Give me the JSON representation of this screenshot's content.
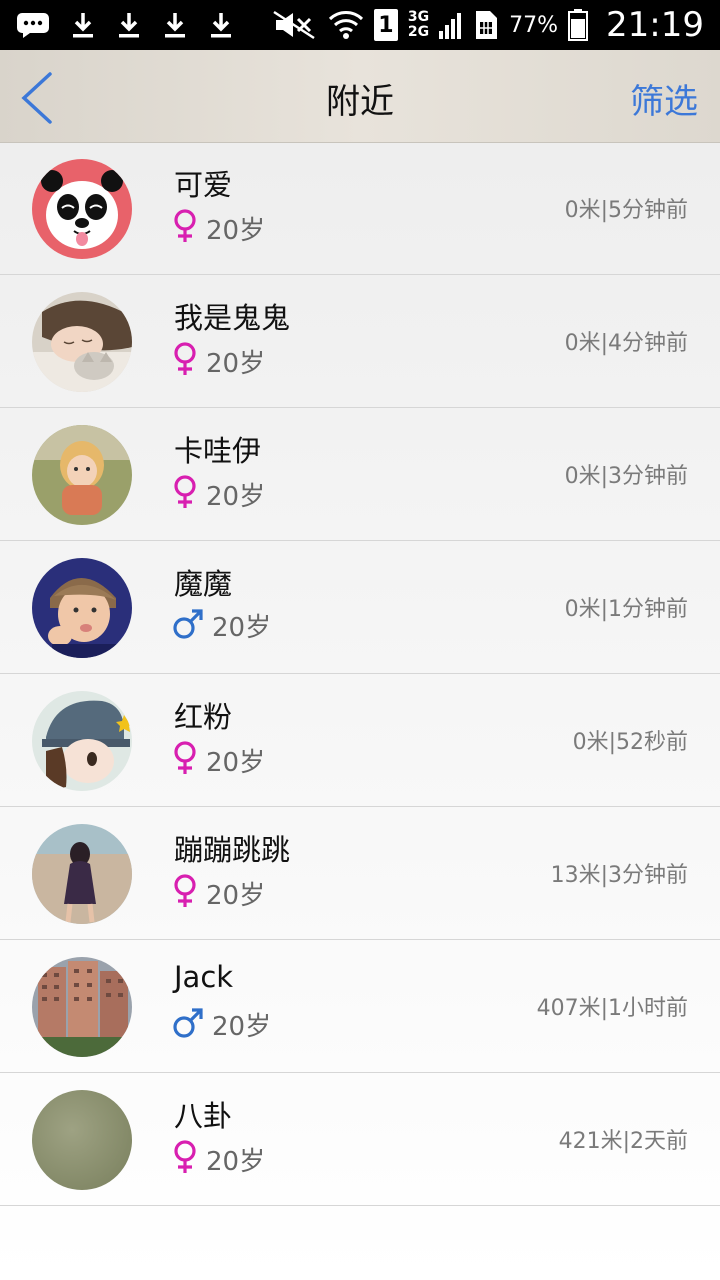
{
  "status_bar": {
    "battery": "77%",
    "time": "21:19",
    "sim": "1",
    "network_top": "3G",
    "network_bottom": "2G",
    "icons": [
      "message-icon",
      "download-icon",
      "download-icon",
      "download-icon",
      "download-icon",
      "mute-icon",
      "wifi-icon",
      "sim-icon",
      "signal-icon",
      "sim-card-icon",
      "battery-icon"
    ]
  },
  "header": {
    "title": "附近",
    "filter_label": "筛选",
    "back_icon": "chevron-left-icon",
    "accent_color": "#3c78d8"
  },
  "users": [
    {
      "name": "可爱",
      "gender": "female",
      "age": "20岁",
      "distance": "0米|5分钟前",
      "avatar": "panda"
    },
    {
      "name": "我是鬼鬼",
      "gender": "female",
      "age": "20岁",
      "distance": "0米|4分钟前",
      "avatar": "sleeping-girl"
    },
    {
      "name": "卡哇伊",
      "gender": "female",
      "age": "20岁",
      "distance": "0米|3分钟前",
      "avatar": "child-on-grass"
    },
    {
      "name": "魔魔",
      "gender": "male",
      "age": "20岁",
      "distance": "0米|1分钟前",
      "avatar": "boy-photo"
    },
    {
      "name": "红粉",
      "gender": "female",
      "age": "20岁",
      "distance": "0米|52秒前",
      "avatar": "cartoon-girl"
    },
    {
      "name": "蹦蹦跳跳",
      "gender": "female",
      "age": "20岁",
      "distance": "13米|3分钟前",
      "avatar": "beach-girl"
    },
    {
      "name": "Jack",
      "gender": "male",
      "age": "20岁",
      "distance": "407米|1小时前",
      "avatar": "buildings"
    },
    {
      "name": "八卦",
      "gender": "female",
      "age": "20岁",
      "distance": "421米|2天前",
      "avatar": "olive-blank"
    }
  ],
  "colors": {
    "female": "#d81fb0",
    "male": "#2f6fc9"
  }
}
